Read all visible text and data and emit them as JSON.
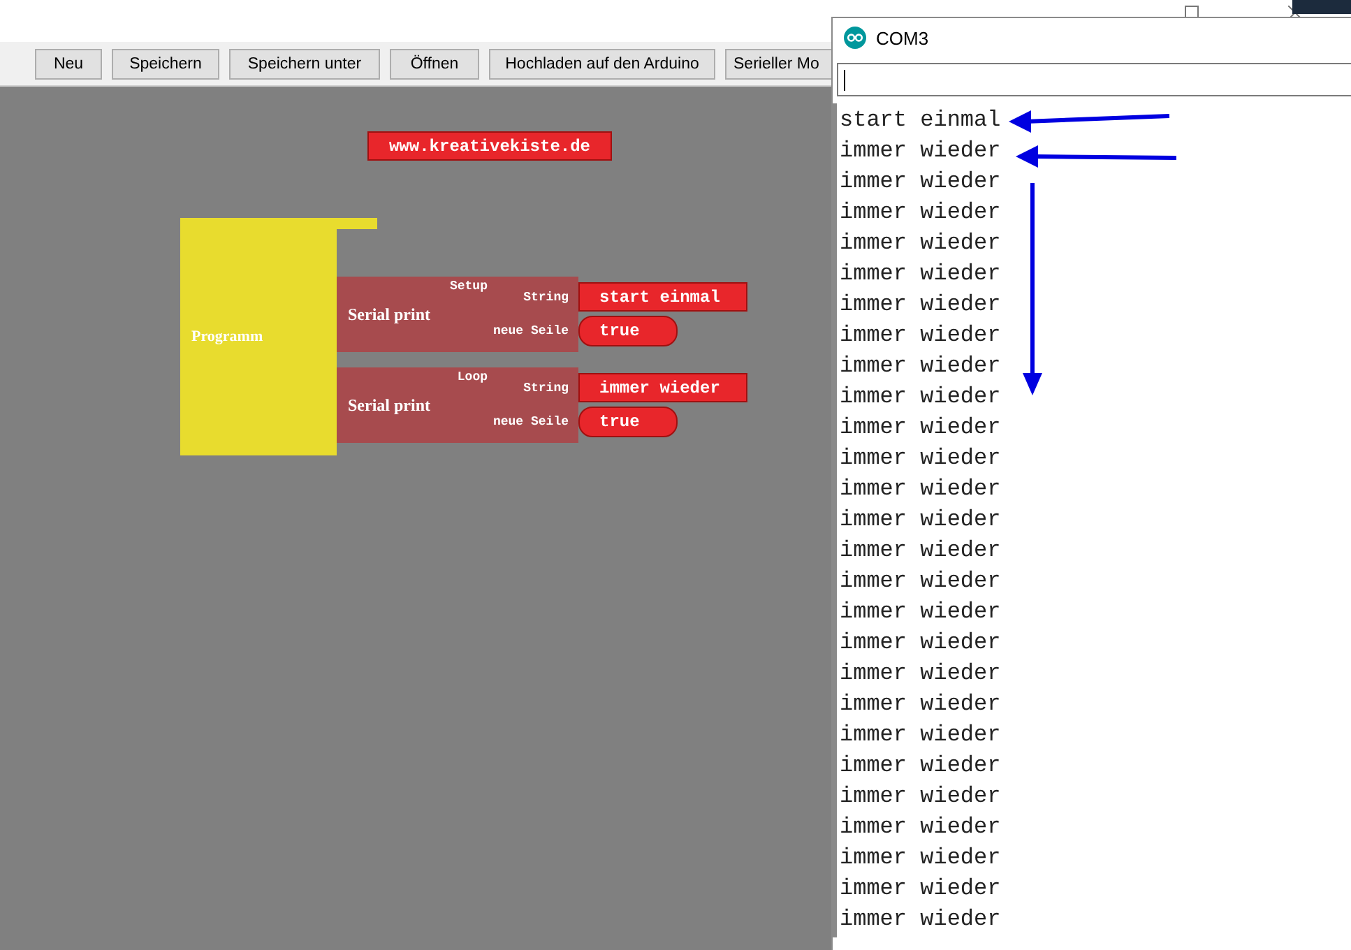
{
  "toolbar": {
    "buttons": [
      "Neu",
      "Speichern",
      "Speichern unter",
      "Öffnen",
      "Hochladen auf den Arduino",
      "Serieller Mo"
    ]
  },
  "canvas": {
    "label_block": "www.kreativekiste.de",
    "program_block": {
      "title": "Programm",
      "sections": [
        {
          "label": "Setup",
          "block": {
            "title": "Serial print",
            "inputs": [
              {
                "label": "String",
                "kind": "text",
                "value": "start einmal"
              },
              {
                "label": "neue Seile",
                "kind": "boolean",
                "value": "true"
              }
            ]
          }
        },
        {
          "label": "Loop",
          "block": {
            "title": "Serial print",
            "inputs": [
              {
                "label": "String",
                "kind": "text",
                "value": "immer wieder"
              },
              {
                "label": "neue Seile",
                "kind": "boolean",
                "value": "true"
              }
            ]
          }
        }
      ]
    }
  },
  "serial_monitor": {
    "title": "COM3",
    "output_lines": [
      "start einmal",
      "immer wieder",
      "immer wieder",
      "immer wieder",
      "immer wieder",
      "immer wieder",
      "immer wieder",
      "immer wieder",
      "immer wieder",
      "immer wieder",
      "immer wieder",
      "immer wieder",
      "immer wieder",
      "immer wieder",
      "immer wieder",
      "immer wieder",
      "immer wieder",
      "immer wieder",
      "immer wieder",
      "immer wieder",
      "immer wieder",
      "immer wieder",
      "immer wieder",
      "immer wieder",
      "immer wieder",
      "immer wieder",
      "immer wieder"
    ]
  }
}
